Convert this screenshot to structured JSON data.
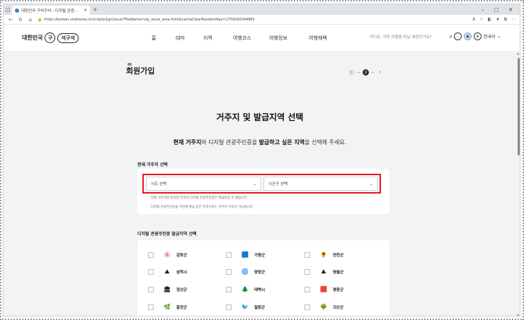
{
  "browser": {
    "tab_title": "대한민국 구석구석 - 디지털 관광...",
    "url": "https://korean.visitkorea.or.kr/spfy/Lgn/Issue?FileName=vip_issue_area.html&cacheClearRandomKey=1750042044965"
  },
  "site": {
    "logo_text1": "대한민국",
    "logo_mark": "구",
    "logo_text2": "석구석",
    "nav": [
      "홈",
      "테마",
      "지역",
      "여행코스",
      "여행정보",
      "여행혜택"
    ],
    "search_placeholder": "어디로, 어떤 여행을 떠날 예정인가요?",
    "language": "한국어"
  },
  "page": {
    "title": "회원가입",
    "steps": [
      "1",
      "2",
      "3"
    ],
    "active_step": "2"
  },
  "main": {
    "heading": "거주지 및 발급지역 선택",
    "subtitle": {
      "part1": "현재 거주지",
      "part2": "와 디지털 관광주민증을 ",
      "part3": "발급하고 싶은 지역",
      "part4": "을 선택해 주세요."
    },
    "residence_label": "현재 거주지 선택",
    "province_placeholder": "시도 선택",
    "district_placeholder": "시군구 선택",
    "note1": "· 현재 거주지와 동일한 지역의 디지털 관광주민증은 발급받을 수 없습니다.",
    "note2": "· 디지털 관광주민증을 이전에 발급 받은 지역으로는 거주지 이동이 가능합니다.",
    "issue_label": "디지털 관광주민증 발급지역 선택",
    "regions": [
      {
        "name": "강화군",
        "icon": "🌸"
      },
      {
        "name": "가평군",
        "icon": "🟦"
      },
      {
        "name": "연천군",
        "icon": "🌻"
      },
      {
        "name": "삼척시",
        "icon": "⛰"
      },
      {
        "name": "양양군",
        "icon": "🌀"
      },
      {
        "name": "영월군",
        "icon": "⛰"
      },
      {
        "name": "정선군",
        "icon": "🏛"
      },
      {
        "name": "태백시",
        "icon": "🌲"
      },
      {
        "name": "평창군",
        "icon": "🟥"
      },
      {
        "name": "홍천군",
        "icon": "🌿"
      },
      {
        "name": "철원군",
        "icon": "🐦"
      },
      {
        "name": "괴산군",
        "icon": "🌳"
      }
    ]
  },
  "colors": {
    "highlight_border": "#e0141b",
    "background": "#f1f3f5"
  }
}
